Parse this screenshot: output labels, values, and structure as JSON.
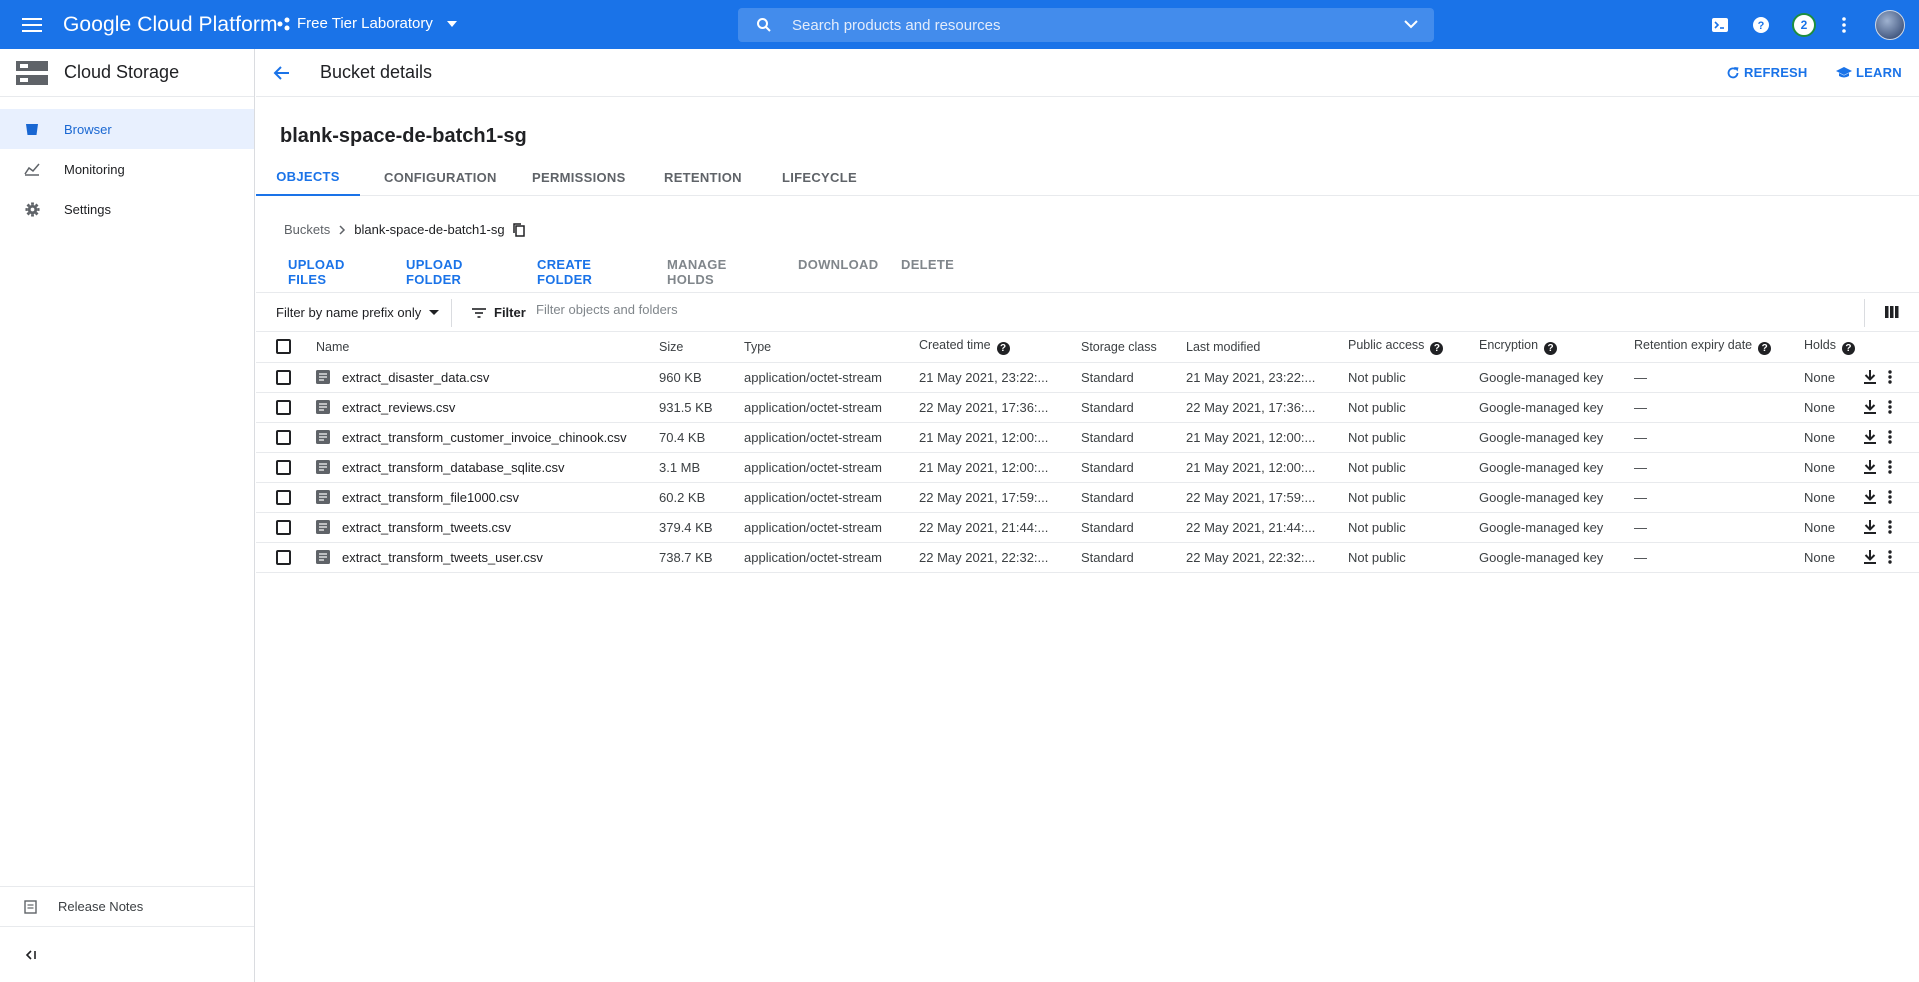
{
  "topbar": {
    "brand": "Google Cloud Platform",
    "project": "Free Tier Laboratory",
    "search_placeholder": "Search products and resources",
    "notifications": "2",
    "accent": "#1a73e8"
  },
  "sidebar": {
    "title": "Cloud Storage",
    "items": [
      {
        "label": "Browser",
        "icon": "bucket-icon"
      },
      {
        "label": "Monitoring",
        "icon": "chart-icon"
      },
      {
        "label": "Settings",
        "icon": "gear-icon"
      }
    ],
    "release_notes": "Release Notes"
  },
  "header": {
    "title": "Bucket details",
    "refresh": "REFRESH",
    "learn": "LEARN"
  },
  "bucket": {
    "name": "blank-space-de-batch1-sg"
  },
  "tabs": [
    "OBJECTS",
    "CONFIGURATION",
    "PERMISSIONS",
    "RETENTION",
    "LIFECYCLE"
  ],
  "breadcrumb": {
    "root": "Buckets",
    "current": "blank-space-de-batch1-sg"
  },
  "actions": {
    "upload_files": "UPLOAD FILES",
    "upload_folder": "UPLOAD FOLDER",
    "create_folder": "CREATE FOLDER",
    "manage_holds": "MANAGE HOLDS",
    "download": "DOWNLOAD",
    "delete": "DELETE"
  },
  "filter": {
    "prefix_label": "Filter by name prefix only",
    "filter_label": "Filter",
    "placeholder": "Filter objects and folders"
  },
  "table": {
    "headers": {
      "name": "Name",
      "size": "Size",
      "type": "Type",
      "created": "Created time",
      "storage_class": "Storage class",
      "last_modified": "Last modified",
      "public_access": "Public access",
      "encryption": "Encryption",
      "retention": "Retention expiry date",
      "holds": "Holds"
    },
    "rows": [
      {
        "name": "extract_disaster_data.csv",
        "size": "960 KB",
        "type": "application/octet-stream",
        "created": "21 May 2021, 23:22:...",
        "storage_class": "Standard",
        "last_modified": "21 May 2021, 23:22:...",
        "public_access": "Not public",
        "encryption": "Google-managed key",
        "retention": "—",
        "holds": "None"
      },
      {
        "name": "extract_reviews.csv",
        "size": "931.5 KB",
        "type": "application/octet-stream",
        "created": "22 May 2021, 17:36:...",
        "storage_class": "Standard",
        "last_modified": "22 May 2021, 17:36:...",
        "public_access": "Not public",
        "encryption": "Google-managed key",
        "retention": "—",
        "holds": "None"
      },
      {
        "name": "extract_transform_customer_invoice_chinook.csv",
        "size": "70.4 KB",
        "type": "application/octet-stream",
        "created": "21 May 2021, 12:00:...",
        "storage_class": "Standard",
        "last_modified": "21 May 2021, 12:00:...",
        "public_access": "Not public",
        "encryption": "Google-managed key",
        "retention": "—",
        "holds": "None"
      },
      {
        "name": "extract_transform_database_sqlite.csv",
        "size": "3.1 MB",
        "type": "application/octet-stream",
        "created": "21 May 2021, 12:00:...",
        "storage_class": "Standard",
        "last_modified": "21 May 2021, 12:00:...",
        "public_access": "Not public",
        "encryption": "Google-managed key",
        "retention": "—",
        "holds": "None"
      },
      {
        "name": "extract_transform_file1000.csv",
        "size": "60.2 KB",
        "type": "application/octet-stream",
        "created": "22 May 2021, 17:59:...",
        "storage_class": "Standard",
        "last_modified": "22 May 2021, 17:59:...",
        "public_access": "Not public",
        "encryption": "Google-managed key",
        "retention": "—",
        "holds": "None"
      },
      {
        "name": "extract_transform_tweets.csv",
        "size": "379.4 KB",
        "type": "application/octet-stream",
        "created": "22 May 2021, 21:44:...",
        "storage_class": "Standard",
        "last_modified": "22 May 2021, 21:44:...",
        "public_access": "Not public",
        "encryption": "Google-managed key",
        "retention": "—",
        "holds": "None"
      },
      {
        "name": "extract_transform_tweets_user.csv",
        "size": "738.7 KB",
        "type": "application/octet-stream",
        "created": "22 May 2021, 22:32:...",
        "storage_class": "Standard",
        "last_modified": "22 May 2021, 22:32:...",
        "public_access": "Not public",
        "encryption": "Google-managed key",
        "retention": "—",
        "holds": "None"
      }
    ]
  }
}
